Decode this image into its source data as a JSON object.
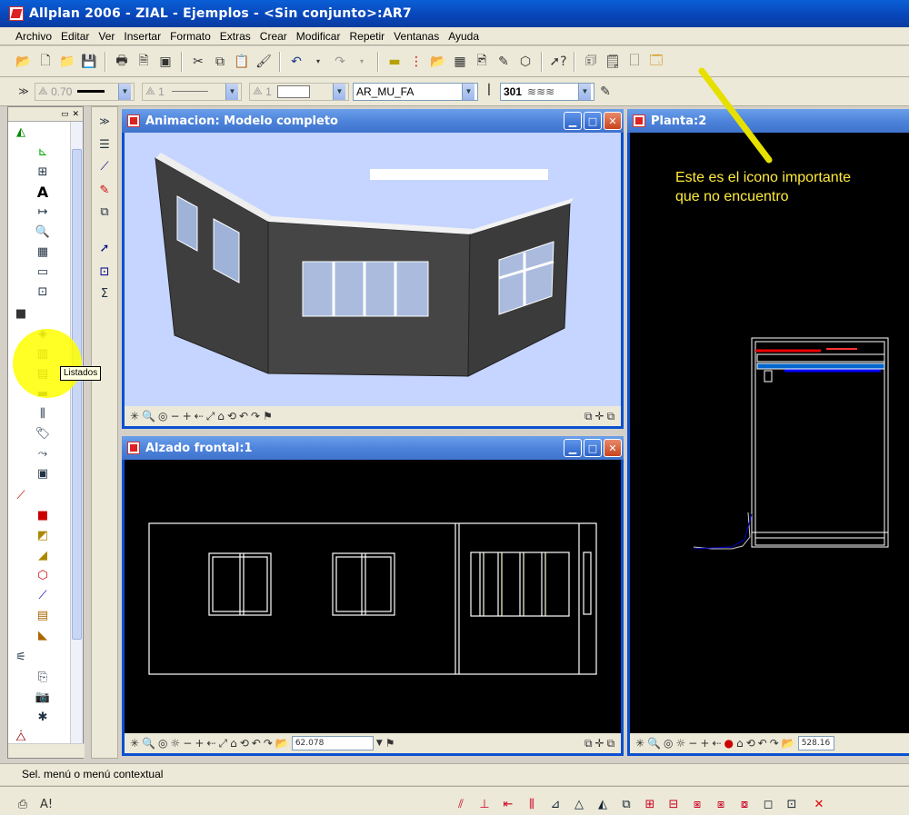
{
  "app": {
    "title": "Allplan 2006 - ZIAL - Ejemplos - <Sin conjunto>:AR7"
  },
  "menu": [
    "Archivo",
    "Editar",
    "Ver",
    "Insertar",
    "Formato",
    "Extras",
    "Crear",
    "Modificar",
    "Repetir",
    "Ventanas",
    "Ayuda"
  ],
  "format_bar": {
    "pen_value": "0.70",
    "line_value": "1",
    "color_value": "1",
    "layer_value": "AR_MU_FA",
    "hatch_value": "301"
  },
  "tooltip": "Listados",
  "windows": {
    "anim": {
      "title": "Animacion: Modelo completo"
    },
    "alzado": {
      "title": "Alzado frontal:1",
      "scale_value": "62.078"
    },
    "planta": {
      "title": "Planta:2",
      "scale_value": "528.16"
    }
  },
  "annotation": {
    "line1": "Este es el icono importante",
    "line2": "que no encuentro",
    "color": "#ffeb3b"
  },
  "status": "Sel. menú o menú contextual",
  "colors": {
    "title_blue": "#0a50d0",
    "canvas_bg": "#000000",
    "anim_bg": "#c6d5ff",
    "highlight": "#ffff00"
  }
}
